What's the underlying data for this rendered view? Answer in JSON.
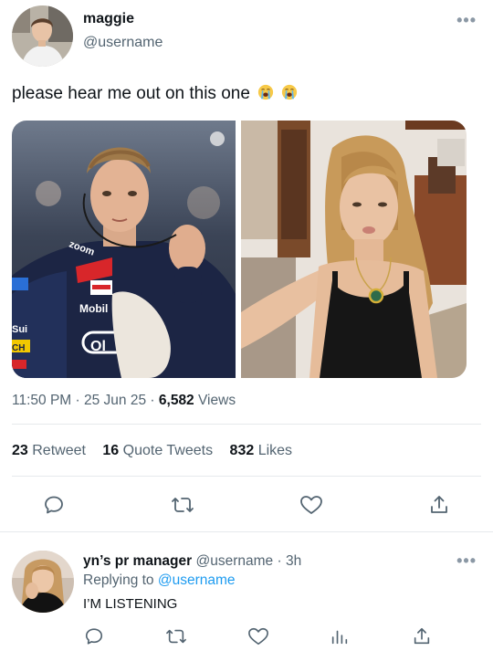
{
  "tweet": {
    "author_name": "maggie",
    "author_handle": "@username",
    "more": "•••",
    "text": "please hear me out on this one",
    "emoji": [
      "loudly-crying-face",
      "loudly-crying-face"
    ],
    "time": "11:50 PM",
    "date": "25 Jun 25",
    "views_count": "6,582",
    "views_label": "Views",
    "separator": "·"
  },
  "stats": {
    "retweets_count": "23",
    "retweets_label": "Retweet",
    "quotes_count": "16",
    "quotes_label": "Quote Tweets",
    "likes_count": "832",
    "likes_label": "Likes"
  },
  "media": [
    {
      "icon": "racing-driver-photo",
      "visible_text": [
        "zoom",
        "TAG",
        "Mobil",
        "Ol",
        "Sui",
        "CH"
      ]
    },
    {
      "icon": "woman-selfie-photo"
    }
  ],
  "actions": [
    "reply-icon",
    "retweet-icon",
    "like-icon",
    "share-icon"
  ],
  "reply": {
    "author_name": "yn’s pr manager",
    "author_handle": "@username",
    "separator": "·",
    "time": "3h",
    "more": "•••",
    "replying_to_label": "Replying to",
    "replying_to_handle": "@username",
    "text": "I’M LISTENING",
    "actions": [
      "reply-icon",
      "retweet-icon",
      "like-icon",
      "views-icon",
      "share-icon"
    ]
  },
  "colors": {
    "text": "#0f1419",
    "secondary": "#536471",
    "link": "#1d9bf0",
    "divider": "#e6e9ec"
  }
}
